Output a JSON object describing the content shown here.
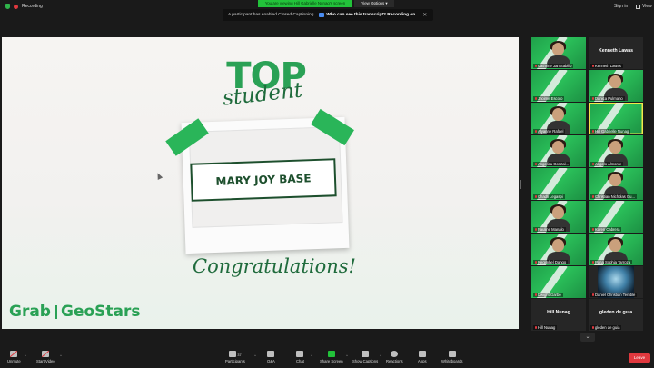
{
  "top_bar": {
    "recording_label": "Recording",
    "share_banner": "You are viewing Hill Gabrielle Nunag's screen",
    "view_options": "View Options",
    "view_options_caret": "▾",
    "sign_in": "Sign in",
    "view": "View"
  },
  "notification": {
    "message": "A participant has enabled Closed Captioning",
    "question": "Who can see this transcript? Recording on",
    "close": "✕"
  },
  "slide": {
    "top": "TOP",
    "student": "student",
    "name": "MARY JOY BASE",
    "congrats": "Congratulations!",
    "brand_left": "Grab",
    "brand_right": "GeoStars"
  },
  "gallery": {
    "tiles": [
      {
        "name": "Cathrine Jan Sabillo",
        "style": "green"
      },
      {
        "name": "Kenneth Lawas",
        "style": "dark",
        "title": "Kenneth Lawas"
      },
      {
        "name": "Jhoime Escoto",
        "style": "green"
      },
      {
        "name": "Danica Pulmano",
        "style": "green"
      },
      {
        "name": "Alyanne Rafael",
        "style": "green"
      },
      {
        "name": "Hill Gabrielle Nunag",
        "style": "green",
        "active": true
      },
      {
        "name": "Angelica Gonzal...",
        "style": "green"
      },
      {
        "name": "Angelo Almonte",
        "style": "green"
      },
      {
        "name": "Chadli Legaspi",
        "style": "green"
      },
      {
        "name": "Christian Nicholas Gu...",
        "style": "green"
      },
      {
        "name": "Pauline Manalo",
        "style": "green"
      },
      {
        "name": "Karen Cabrera",
        "style": "green"
      },
      {
        "name": "Regimhel Dango",
        "style": "green"
      },
      {
        "name": "Pana Sophia Tarroza",
        "style": "green"
      },
      {
        "name": "Dwight Garbo",
        "style": "green"
      },
      {
        "name": "Daniel Christian Terrible",
        "style": "photo"
      },
      {
        "name": "Hill Nunag",
        "style": "dark",
        "title": "Hill Nunag"
      },
      {
        "name": "gleden de guia",
        "style": "dark",
        "title": "gleden de guia"
      }
    ],
    "scroll_down": "⌄"
  },
  "toolbar": {
    "unmute": "Unmute",
    "start_video": "Start Video",
    "participants": "Participants",
    "participants_count": "37",
    "qa": "Q&A",
    "chat": "Chat",
    "share_screen": "Share Screen",
    "show_captions": "Show Captions",
    "reactions": "Reactions",
    "apps": "Apps",
    "whiteboards": "Whiteboards",
    "leave": "Leave",
    "caret": "^"
  },
  "colors": {
    "accent_green": "#2aa155",
    "dark_green": "#1d4f2d",
    "banner_green": "#22c23a",
    "leave_red": "#e0383e"
  }
}
